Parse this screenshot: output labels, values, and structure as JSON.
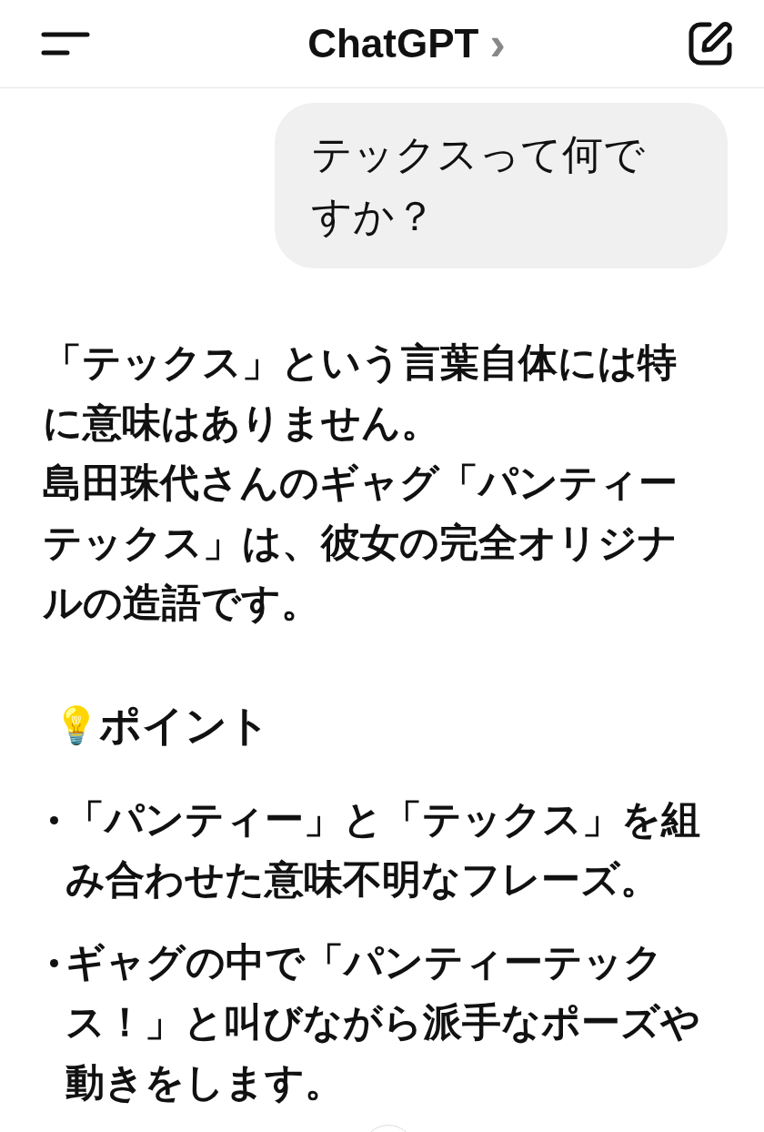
{
  "header": {
    "title": "ChatGPT",
    "chevron": "›"
  },
  "messages": [
    {
      "kind": "user",
      "text": "テックスって何ですか？"
    },
    {
      "kind": "assistant",
      "paragraphs": [
        "「テックス」という言葉自体には特に意味はありません。",
        "島田珠代さんのギャグ「パンティーテックス」は、彼女の完全オリジナルの造語です。"
      ],
      "heading": {
        "emoji": "💡",
        "text": "ポイント"
      },
      "bullets": [
        "「パンティー」と「テックス」を組み合わせた意味不明なフレーズ。",
        "ギャグの中で「パンティーテックス！」と叫びながら派手なポーズや動きをします。"
      ]
    }
  ]
}
